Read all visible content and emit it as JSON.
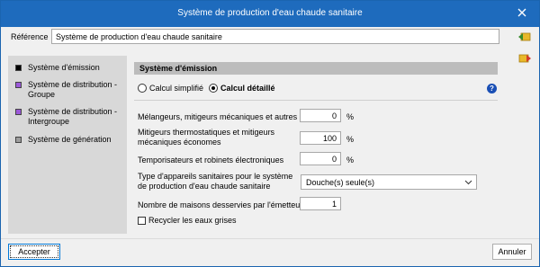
{
  "window": {
    "title": "Système de production d'eau chaude sanitaire"
  },
  "reference": {
    "label": "Référence",
    "value": "Système de production d'eau chaude sanitaire"
  },
  "side_icons": [
    "arrow-left-yellow-icon",
    "arrow-right-yellow-icon"
  ],
  "nav": {
    "items": [
      {
        "label": "Système d'émission",
        "swatch": "#000000"
      },
      {
        "label": "Système de distribution - Groupe",
        "swatch": "#9b59d8"
      },
      {
        "label": "Système de distribution - Intergroupe",
        "swatch": "#9b59d8"
      },
      {
        "label": "Système de génération",
        "swatch": "#9c9c9c"
      }
    ]
  },
  "section": {
    "title": "Système d'émission"
  },
  "calc_mode": {
    "simple_label": "Calcul simplifié",
    "detailed_label": "Calcul détaillé",
    "selected": "detailed"
  },
  "fields": {
    "melangeurs": {
      "label": "Mélangeurs, mitigeurs mécaniques et autres",
      "value": "0",
      "unit": "%"
    },
    "thermostatiques": {
      "label": "Mitigeurs thermostatiques et mitigeurs mécaniques économes",
      "value": "100",
      "unit": "%"
    },
    "temporisateurs": {
      "label": "Temporisateurs et robinets électroniques",
      "value": "0",
      "unit": "%"
    },
    "appareils": {
      "label": "Type d'appareils sanitaires pour le système de production d'eau chaude sanitaire",
      "value": "Douche(s) seule(s)"
    },
    "maisons": {
      "label": "Nombre de maisons desservies par l'émetteur",
      "value": "1"
    }
  },
  "recycle": {
    "label": "Recycler les eaux grises",
    "checked": false
  },
  "buttons": {
    "accept": "Accepter",
    "cancel": "Annuler"
  },
  "colors": {
    "titlebar": "#1e6bbd",
    "help": "#1a4fb5"
  }
}
